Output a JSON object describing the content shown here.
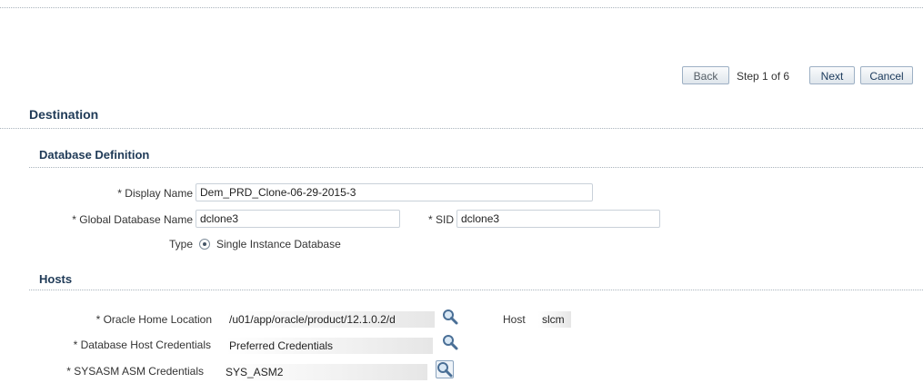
{
  "train": {
    "back_label": "Back",
    "step_text": "Step 1 of 6",
    "next_label": "Next",
    "cancel_label": "Cancel"
  },
  "page": {
    "section_title": "Destination"
  },
  "database_definition": {
    "title": "Database Definition",
    "display_name": {
      "label": "* Display Name",
      "value": "Dem_PRD_Clone-06-29-2015-3"
    },
    "global_db_name": {
      "label": "* Global Database Name",
      "value": "dclone3"
    },
    "sid": {
      "label": "* SID",
      "value": "dclone3"
    },
    "type": {
      "label": "Type",
      "option": "Single Instance Database"
    }
  },
  "hosts": {
    "title": "Hosts",
    "oracle_home": {
      "label": "* Oracle Home Location",
      "value": "/u01/app/oracle/product/12.1.0.2/d"
    },
    "host": {
      "label": "Host",
      "value": "slcm"
    },
    "db_host_credentials": {
      "label": "* Database Host Credentials",
      "value": "Preferred Credentials"
    },
    "sysasm_credentials": {
      "label": "* SYSASM ASM Credentials",
      "value": "SYS_ASM2"
    }
  }
}
